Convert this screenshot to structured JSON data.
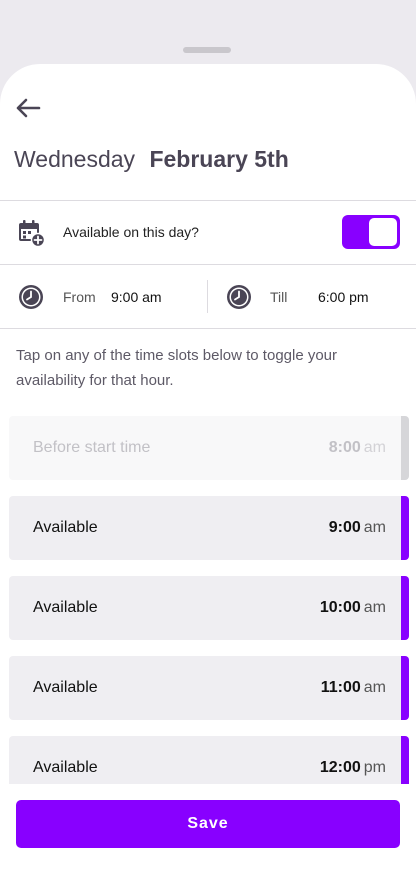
{
  "header": {
    "weekday": "Wednesday",
    "date": "February 5th",
    "back_icon": "arrow-left-icon"
  },
  "availability": {
    "label": "Available on this day?",
    "icon": "calendar-add-icon",
    "enabled": true
  },
  "time_range": {
    "from_label": "From",
    "from_value": "9:00 am",
    "till_label": "Till",
    "till_value": "6:00 pm",
    "icon": "clock-icon"
  },
  "hint": "Tap on any of the time slots below to toggle your availability for that hour.",
  "slots": [
    {
      "status": "Before start time",
      "hour": "8:00",
      "ampm": "am",
      "enabled": false
    },
    {
      "status": "Available",
      "hour": "9:00",
      "ampm": "am",
      "enabled": true
    },
    {
      "status": "Available",
      "hour": "10:00",
      "ampm": "am",
      "enabled": true
    },
    {
      "status": "Available",
      "hour": "11:00",
      "ampm": "am",
      "enabled": true
    },
    {
      "status": "Available",
      "hour": "12:00",
      "ampm": "pm",
      "enabled": true
    }
  ],
  "footer": {
    "save_label": "Save"
  },
  "colors": {
    "accent": "#8800ff",
    "slot_bg": "#efeef2",
    "disabled_bar": "#d6d6d9",
    "text_dark": "#4a4555"
  }
}
